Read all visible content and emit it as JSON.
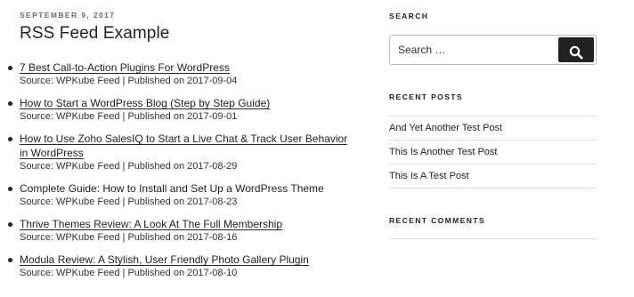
{
  "post": {
    "date": "September 9, 2017",
    "title": "RSS Feed Example",
    "feed_items": [
      {
        "title": "7 Best Call-to-Action Plugins For WordPress",
        "meta": "Source: WPKube Feed | Published on 2017-09-04",
        "linked": true
      },
      {
        "title": "How to Start a WordPress Blog (Step by Step Guide)",
        "meta": "Source: WPKube Feed | Published on 2017-09-01",
        "linked": true
      },
      {
        "title": "How to Use Zoho SalesIQ to Start a Live Chat & Track User Behavior in WordPress",
        "meta": "Source: WPKube Feed | Published on 2017-08-29",
        "linked": true
      },
      {
        "title": "Complete Guide: How to Install and Set Up a WordPress Theme",
        "meta": "Source: WPKube Feed | Published on 2017-08-23",
        "linked": false
      },
      {
        "title": "Thrive Themes Review: A Look At The Full Membership",
        "meta": "Source: WPKube Feed | Published on 2017-08-16",
        "linked": true
      },
      {
        "title": "Modula Review: A Stylish, User Friendly Photo Gallery Plugin",
        "meta": "Source: WPKube Feed | Published on 2017-08-10",
        "linked": true
      }
    ]
  },
  "sidebar": {
    "search": {
      "title": "Search",
      "placeholder": "Search …",
      "button_icon": "search-icon"
    },
    "recent_posts": {
      "title": "Recent Posts",
      "items": [
        "And Yet Another Test Post",
        "This Is Another Test Post",
        "This Is A Test Post"
      ]
    },
    "recent_comments": {
      "title": "Recent Comments"
    }
  },
  "colors": {
    "text": "#222222",
    "meta_label": "#6b6b6b",
    "rule": "#dddddd",
    "search_button": "#222222"
  }
}
